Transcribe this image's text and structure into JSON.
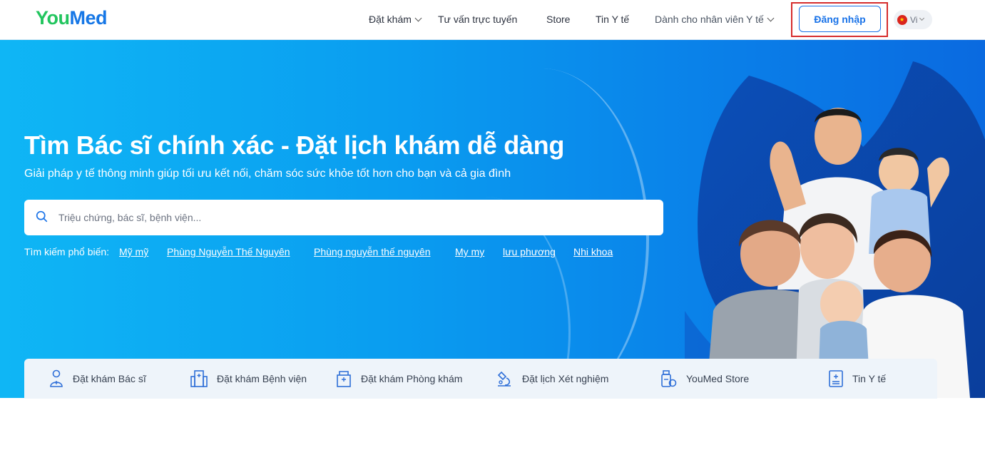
{
  "header": {
    "logo_you": "You",
    "logo_med": "Med",
    "nav": {
      "dat_kham": "Đặt khám",
      "tu_van": "Tư vấn trực tuyến",
      "store": "Store",
      "tin_y_te": "Tin Y tế",
      "nhan_vien": "Dành cho nhân viên Y tế"
    },
    "login_label": "Đăng nhập",
    "lang_label": "Vi"
  },
  "hero": {
    "title": "Tìm Bác sĩ chính xác - Đặt lịch khám dễ dàng",
    "subtitle": "Giải pháp y tế thông minh giúp tối ưu kết nối, chăm sóc sức khỏe tốt hơn cho bạn và cả gia đình",
    "search_placeholder": "Triệu chứng, bác sĩ, bệnh viện...",
    "popular_label": "Tìm kiếm phổ biến:",
    "popular_links": [
      "Mỹ mỹ",
      "Phùng Nguyễn Thế Nguyên",
      "Phùng nguyễn thế nguyên",
      "My my",
      "lưu phương",
      "Nhi khoa"
    ]
  },
  "services": [
    {
      "label": "Đặt khám Bác sĩ",
      "icon": "doctor-icon"
    },
    {
      "label": "Đặt khám Bệnh viện",
      "icon": "hospital-icon"
    },
    {
      "label": "Đặt khám Phòng khám",
      "icon": "clinic-icon"
    },
    {
      "label": "Đặt lịch Xét nghiệm",
      "icon": "microscope-icon"
    },
    {
      "label": "YouMed Store",
      "icon": "pharmacy-icon"
    },
    {
      "label": "Tin Y tế",
      "icon": "news-icon"
    }
  ],
  "colors": {
    "brand_green": "#22c55e",
    "brand_blue": "#1677e6",
    "hero_start": "#0fb6f5",
    "hero_end": "#0a6ae0",
    "highlight_red": "#d62d2d"
  }
}
